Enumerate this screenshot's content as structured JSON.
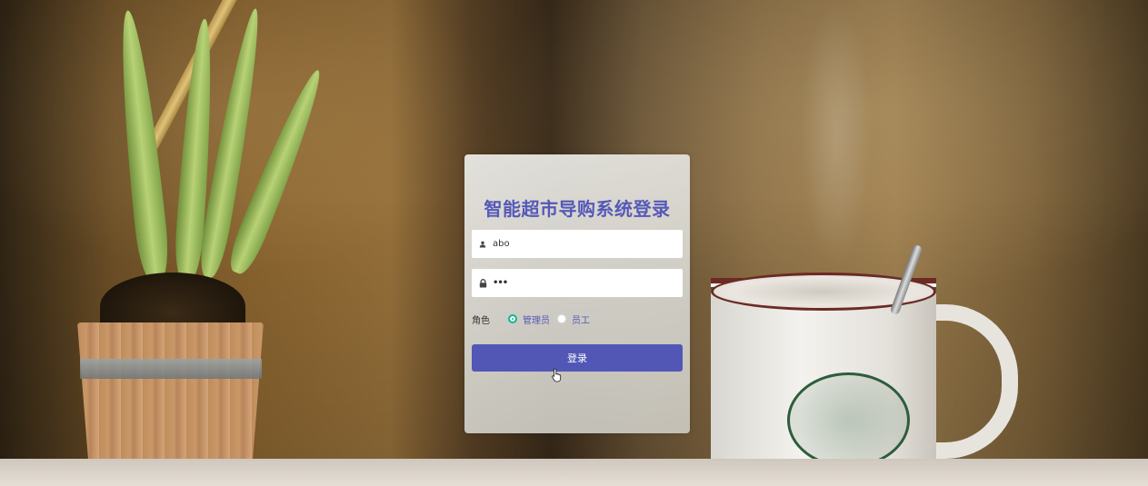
{
  "login": {
    "title": "智能超市导购系统登录",
    "username_value": "abo",
    "password_value": "•••",
    "role_label": "角色",
    "role_options": [
      {
        "label": "管理员",
        "selected": true
      },
      {
        "label": "员工",
        "selected": false
      }
    ],
    "submit_label": "登录"
  },
  "colors": {
    "accent": "#5257b5",
    "title": "#5559b8",
    "radio_checked": "#13b794"
  },
  "icons": {
    "username": "user-icon",
    "password": "lock-icon",
    "cursor": "hand-pointer-icon"
  }
}
